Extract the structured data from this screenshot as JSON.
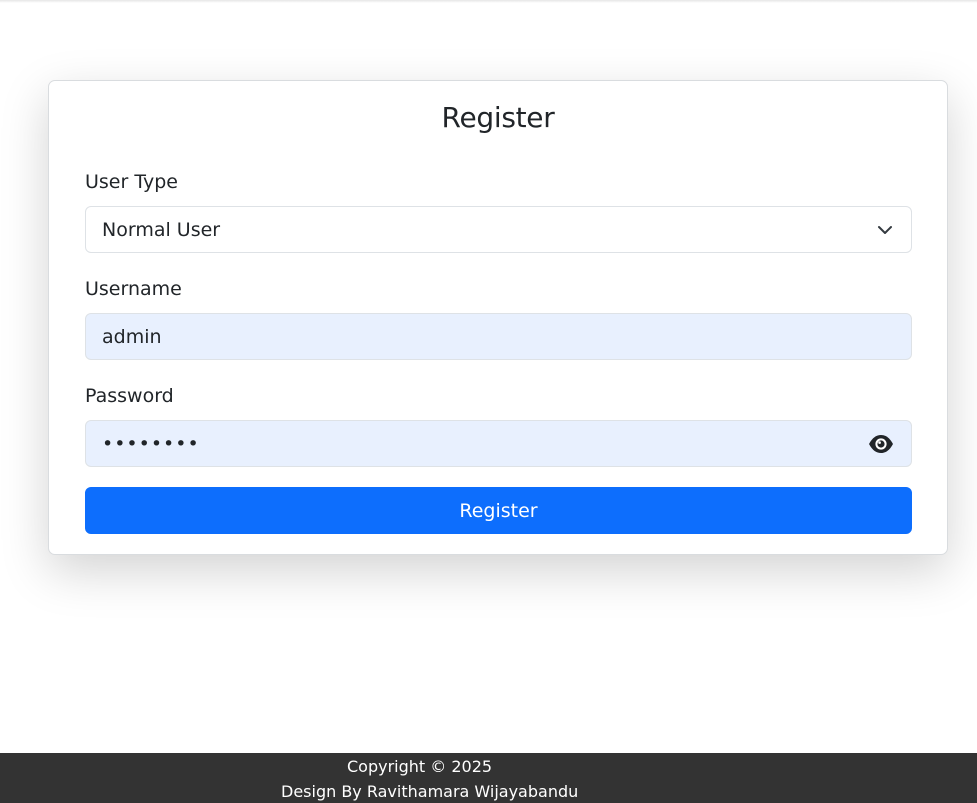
{
  "form": {
    "title": "Register",
    "user_type": {
      "label": "User Type",
      "selected": "Normal User"
    },
    "username": {
      "label": "Username",
      "value": "admin"
    },
    "password": {
      "label": "Password",
      "value_masked": "••••••••",
      "toggle_icon": "eye-icon"
    },
    "submit_label": "Register"
  },
  "footer": {
    "copyright": "Copyright © 2025",
    "credit": "Design By Ravithamara Wijayabandu"
  },
  "colors": {
    "primary": "#0d6efd",
    "autofill_bg": "#e8f0fe",
    "footer_bg": "#333333"
  }
}
